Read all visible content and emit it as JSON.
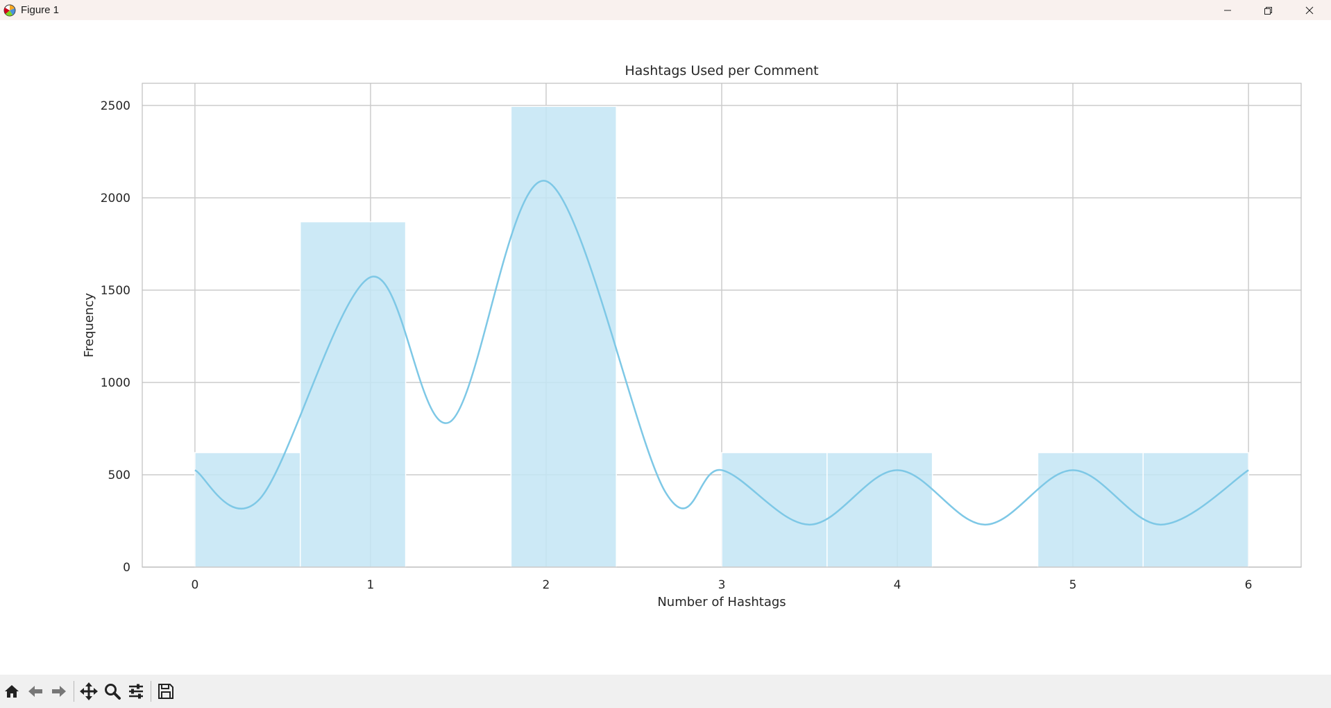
{
  "window": {
    "title": "Figure 1",
    "icons": [
      "matplotlib-icon",
      "minimize-icon",
      "restore-icon",
      "close-icon"
    ]
  },
  "toolbar": {
    "buttons": [
      {
        "name": "home-button",
        "icon": "home-icon"
      },
      {
        "name": "back-button",
        "icon": "arrow-left-icon"
      },
      {
        "name": "forward-button",
        "icon": "arrow-right-icon"
      },
      {
        "name": "pan-button",
        "icon": "move-icon"
      },
      {
        "name": "zoom-button",
        "icon": "magnifier-icon"
      },
      {
        "name": "configure-subplots-button",
        "icon": "sliders-icon"
      },
      {
        "name": "save-button",
        "icon": "floppy-disk-icon"
      }
    ]
  },
  "chart_data": {
    "type": "bar",
    "title": "Hashtags Used per Comment",
    "xlabel": "Number of Hashtags",
    "ylabel": "Frequency",
    "xlim": [
      -0.3,
      6.3
    ],
    "ylim": [
      0,
      2620
    ],
    "xticks": [
      0,
      1,
      2,
      3,
      4,
      5,
      6
    ],
    "yticks": [
      0,
      500,
      1000,
      1500,
      2000,
      2500
    ],
    "grid": true,
    "bins": [
      {
        "x0": 0.0,
        "x1": 0.6,
        "count": 620
      },
      {
        "x0": 0.6,
        "x1": 1.2,
        "count": 1870
      },
      {
        "x0": 1.2,
        "x1": 1.8,
        "count": 0
      },
      {
        "x0": 1.8,
        "x1": 2.4,
        "count": 2495
      },
      {
        "x0": 2.4,
        "x1": 3.0,
        "count": 0
      },
      {
        "x0": 3.0,
        "x1": 3.6,
        "count": 620
      },
      {
        "x0": 3.6,
        "x1": 4.2,
        "count": 620
      },
      {
        "x0": 4.2,
        "x1": 4.8,
        "count": 0
      },
      {
        "x0": 4.8,
        "x1": 5.4,
        "count": 620
      },
      {
        "x0": 5.4,
        "x1": 6.0,
        "count": 620
      }
    ],
    "kde": {
      "x": [
        0,
        0.37,
        1.0,
        1.45,
        2.0,
        2.68,
        3.0,
        3.5,
        4.0,
        4.5,
        5.0,
        5.5,
        6.0
      ],
      "y": [
        525,
        370,
        1570,
        785,
        2090,
        405,
        525,
        230,
        525,
        230,
        525,
        230,
        525
      ]
    },
    "colors": {
      "bar": "#c3e5f4",
      "kde": "#7ec8e6",
      "grid": "#cccccc",
      "axes": "#bfbfbf"
    }
  }
}
